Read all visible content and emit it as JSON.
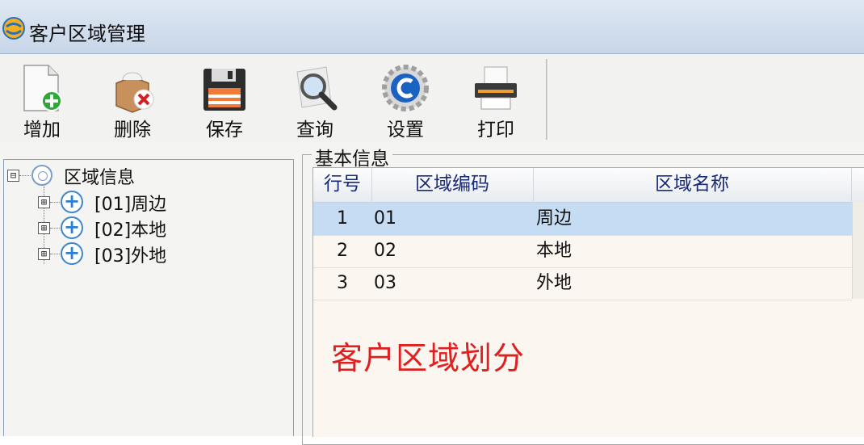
{
  "window": {
    "title": "客户区域管理"
  },
  "toolbar": {
    "buttons": [
      {
        "id": "add",
        "label": "增加",
        "icon": "add-document-icon"
      },
      {
        "id": "delete",
        "label": "删除",
        "icon": "delete-box-icon"
      },
      {
        "id": "save",
        "label": "保存",
        "icon": "floppy-disk-icon"
      },
      {
        "id": "query",
        "label": "查询",
        "icon": "magnifier-icon"
      },
      {
        "id": "settings",
        "label": "设置",
        "icon": "gear-icon"
      },
      {
        "id": "print",
        "label": "打印",
        "icon": "printer-icon"
      }
    ]
  },
  "tree": {
    "root": {
      "label": "区域信息",
      "expander": "⊟"
    },
    "children": [
      {
        "label": "[01]周边",
        "expander": "⊞"
      },
      {
        "label": "[02]本地",
        "expander": "⊞"
      },
      {
        "label": "[03]外地",
        "expander": "⊞"
      }
    ]
  },
  "group": {
    "legend": "基本信息"
  },
  "grid": {
    "columns": [
      "行号",
      "区域编码",
      "区域名称"
    ],
    "rows": [
      {
        "row_no": "1",
        "code": "01",
        "name": "周边",
        "selected": true
      },
      {
        "row_no": "2",
        "code": "02",
        "name": "本地",
        "selected": false
      },
      {
        "row_no": "3",
        "code": "03",
        "name": "外地",
        "selected": false
      }
    ]
  },
  "caption": "客户区域划分",
  "colors": {
    "caption": "#e02020",
    "selection": "#c5dcf2",
    "header_text": "#1a2a7a"
  }
}
